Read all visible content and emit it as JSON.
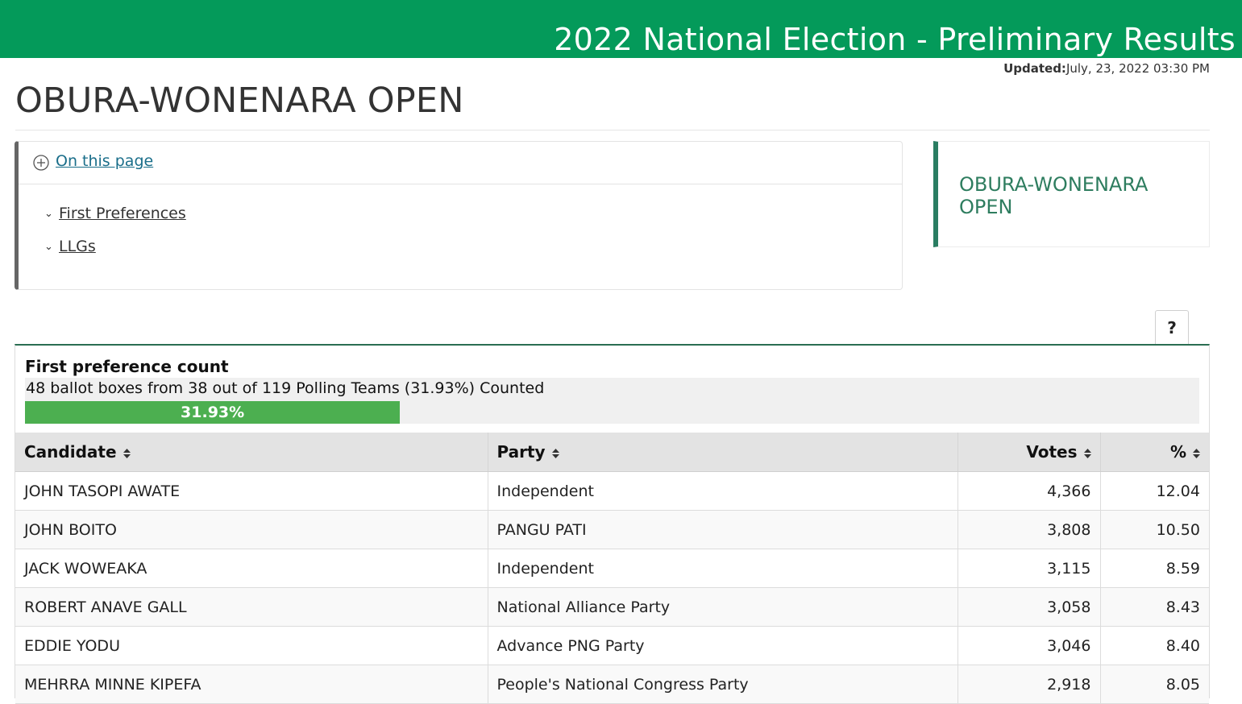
{
  "header": {
    "banner_title": "2022 National Election - Preliminary Results",
    "updated_label": "Updated:",
    "updated_value": "July, 23, 2022 03:30 PM",
    "brand_color": "#049a5a"
  },
  "page": {
    "title": "OBURA-WONENARA OPEN"
  },
  "toc": {
    "toggle_label": "On this page",
    "items": [
      {
        "label": "First Preferences"
      },
      {
        "label": "LLGs"
      }
    ]
  },
  "side_card": {
    "title": "OBURA-WONENARA OPEN"
  },
  "help": {
    "label": "?"
  },
  "count": {
    "title": "First preference count",
    "summary": "48 ballot boxes from 38 out of 119 Polling Teams (31.93%) Counted",
    "progress_label": "31.93%",
    "progress_fraction": 0.3193,
    "progress_color": "#4caf50"
  },
  "table": {
    "columns": [
      "Candidate",
      "Party",
      "Votes",
      "%"
    ],
    "rows": [
      {
        "candidate": "JOHN TASOPI AWATE",
        "party": "Independent",
        "votes": "4,366",
        "pct": "12.04"
      },
      {
        "candidate": "JOHN BOITO",
        "party": "PANGU PATI",
        "votes": "3,808",
        "pct": "10.50"
      },
      {
        "candidate": "JACK WOWEAKA",
        "party": "Independent",
        "votes": "3,115",
        "pct": "8.59"
      },
      {
        "candidate": "ROBERT ANAVE GALL",
        "party": "National Alliance Party",
        "votes": "3,058",
        "pct": "8.43"
      },
      {
        "candidate": "EDDIE YODU",
        "party": "Advance PNG Party",
        "votes": "3,046",
        "pct": "8.40"
      },
      {
        "candidate": "MEHRRA MINNE KIPEFA",
        "party": "People's National Congress Party",
        "votes": "2,918",
        "pct": "8.05"
      }
    ]
  }
}
